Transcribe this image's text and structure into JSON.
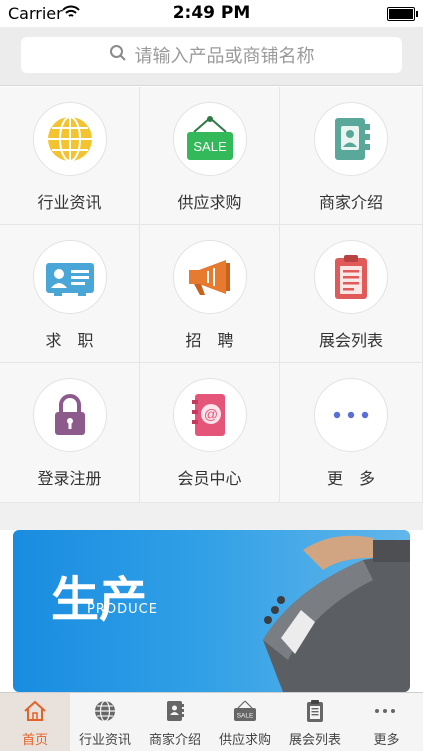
{
  "status_bar": {
    "carrier": "Carrier",
    "time": "2:49 PM"
  },
  "search": {
    "placeholder": "请输入产品或商铺名称"
  },
  "grid": {
    "items": [
      {
        "label": "行业资讯",
        "icon": "globe-icon"
      },
      {
        "label": "供应求购",
        "icon": "sale-sign-icon"
      },
      {
        "label": "商家介绍",
        "icon": "address-book-icon"
      },
      {
        "label": "求　职",
        "icon": "id-card-icon"
      },
      {
        "label": "招　聘",
        "icon": "megaphone-icon"
      },
      {
        "label": "展会列表",
        "icon": "clipboard-icon"
      },
      {
        "label": "登录注册",
        "icon": "lock-icon"
      },
      {
        "label": "会员中心",
        "icon": "at-notebook-icon"
      },
      {
        "label": "更　多",
        "icon": "more-dots-icon"
      }
    ]
  },
  "banner": {
    "brush_text": "生产",
    "produce_text": "PRODUCE"
  },
  "tabbar": {
    "items": [
      {
        "label": "首页",
        "icon": "home-icon",
        "active": true
      },
      {
        "label": "行业资讯",
        "icon": "globe-icon"
      },
      {
        "label": "商家介绍",
        "icon": "address-book-icon"
      },
      {
        "label": "供应求购",
        "icon": "sale-sign-icon"
      },
      {
        "label": "展会列表",
        "icon": "clipboard-icon"
      },
      {
        "label": "更多",
        "icon": "more-dots-icon"
      }
    ]
  },
  "colors": {
    "accent": "#e2632a",
    "globe": "#f4c430",
    "sale": "#33b85a",
    "teal": "#5aa89a",
    "idcard": "#4aa6d6",
    "megaphone": "#e67a2e",
    "clipboard": "#e05a5a",
    "lock": "#8d5a8c",
    "notebook": "#e5557a",
    "dots": "#5a6fd6"
  }
}
